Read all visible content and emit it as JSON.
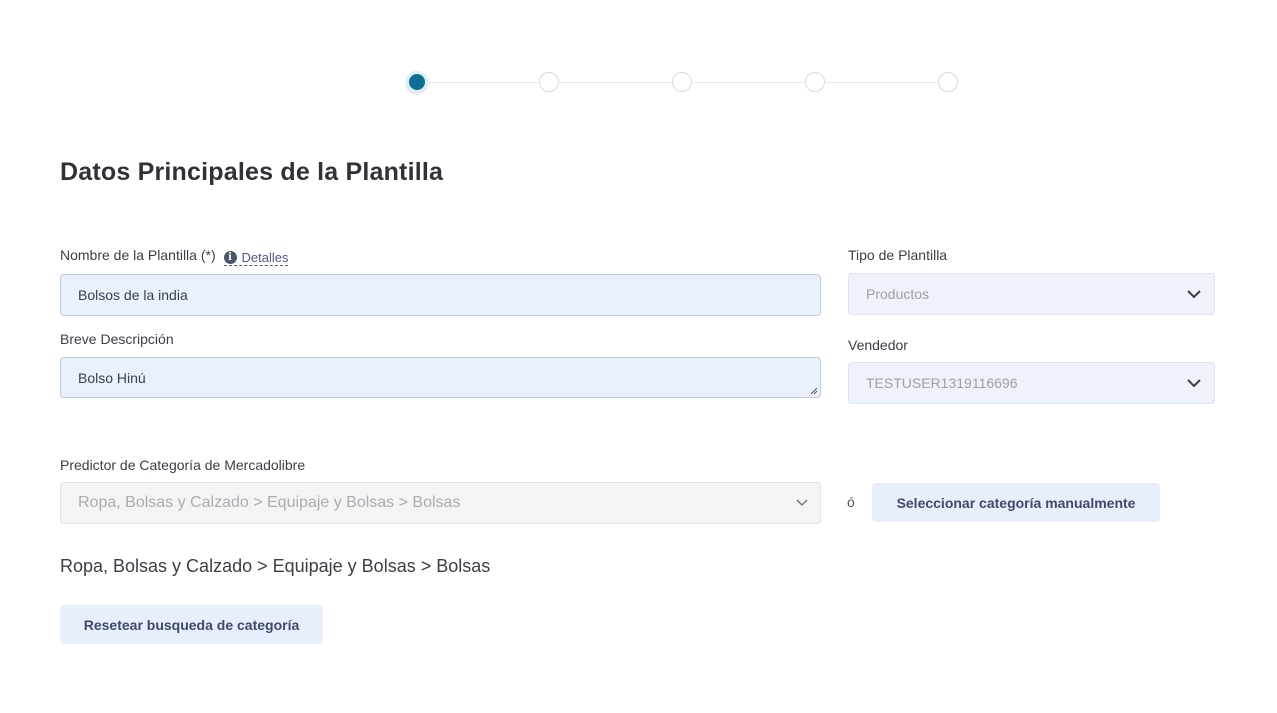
{
  "stepper": {
    "steps": 5,
    "active_index": 0
  },
  "page_title": "Datos Principales de la Plantilla",
  "template_name": {
    "label": "Nombre de la Plantilla (*)",
    "details_link": "Detalles",
    "value": "Bolsos de la india"
  },
  "short_description": {
    "label": "Breve Descripción",
    "value": "Bolso Hinú"
  },
  "template_type": {
    "label": "Tipo de Plantilla",
    "selected": "Productos"
  },
  "seller": {
    "label": "Vendedor",
    "selected": "TESTUSER1319116696"
  },
  "category_predictor": {
    "label": "Predictor de Categoría de Mercadolibre",
    "selected": "Ropa, Bolsas y Calzado > Equipaje y Bolsas > Bolsas",
    "or_text": "ó",
    "manual_button": "Seleccionar categoría manualmente"
  },
  "selected_category_path": "Ropa, Bolsas y Calzado > Equipaje y Bolsas > Bolsas",
  "reset_button": "Resetear busqueda de categoría",
  "colors": {
    "accent": "#0f6e94",
    "input_bg": "#eaf0fc",
    "button_bg": "#e8eefb"
  }
}
